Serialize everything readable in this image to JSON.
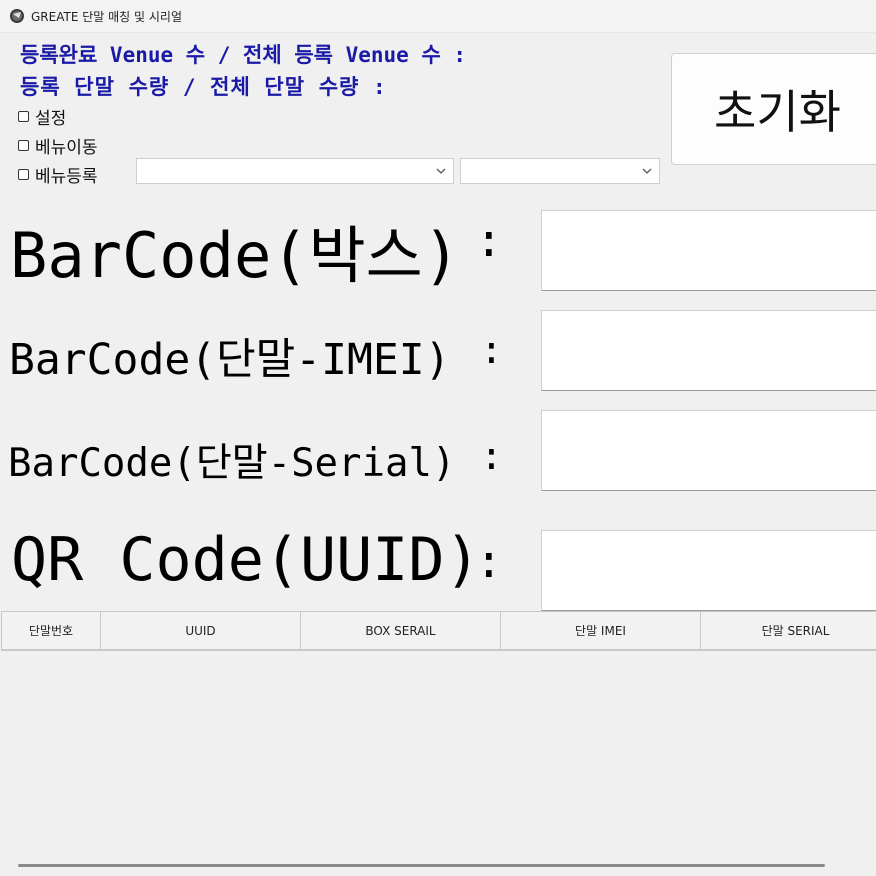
{
  "window": {
    "title": "GREATE 단말 매칭 및 시리얼"
  },
  "stats": {
    "line1": "등록완료 Venue 수 / 전체 등록 Venue 수 :",
    "line2": "등록 단말 수량 / 전체 단말 수량 :"
  },
  "options": [
    {
      "label": "설정",
      "checked": false
    },
    {
      "label": "베뉴이동",
      "checked": false
    },
    {
      "label": "베뉴등록",
      "checked": false
    }
  ],
  "combos": [
    {
      "value": ""
    },
    {
      "value": ""
    }
  ],
  "reset_button": {
    "label": "초기화"
  },
  "barcodes": {
    "box": {
      "label": "BarCode(박스)",
      "colon": ":",
      "value": ""
    },
    "imei": {
      "label": "BarCode(단말-IMEI)",
      "colon": ":",
      "value": ""
    },
    "serial": {
      "label": "BarCode(단말-Serial)",
      "colon": ":",
      "value": ""
    },
    "qr": {
      "label": "QR Code(UUID)",
      "colon": ":",
      "value": ""
    }
  },
  "table": {
    "columns": [
      "단말번호",
      "UUID",
      "BOX SERAIL",
      "단말 IMEI",
      "단말 SERIAL"
    ],
    "rows": []
  }
}
